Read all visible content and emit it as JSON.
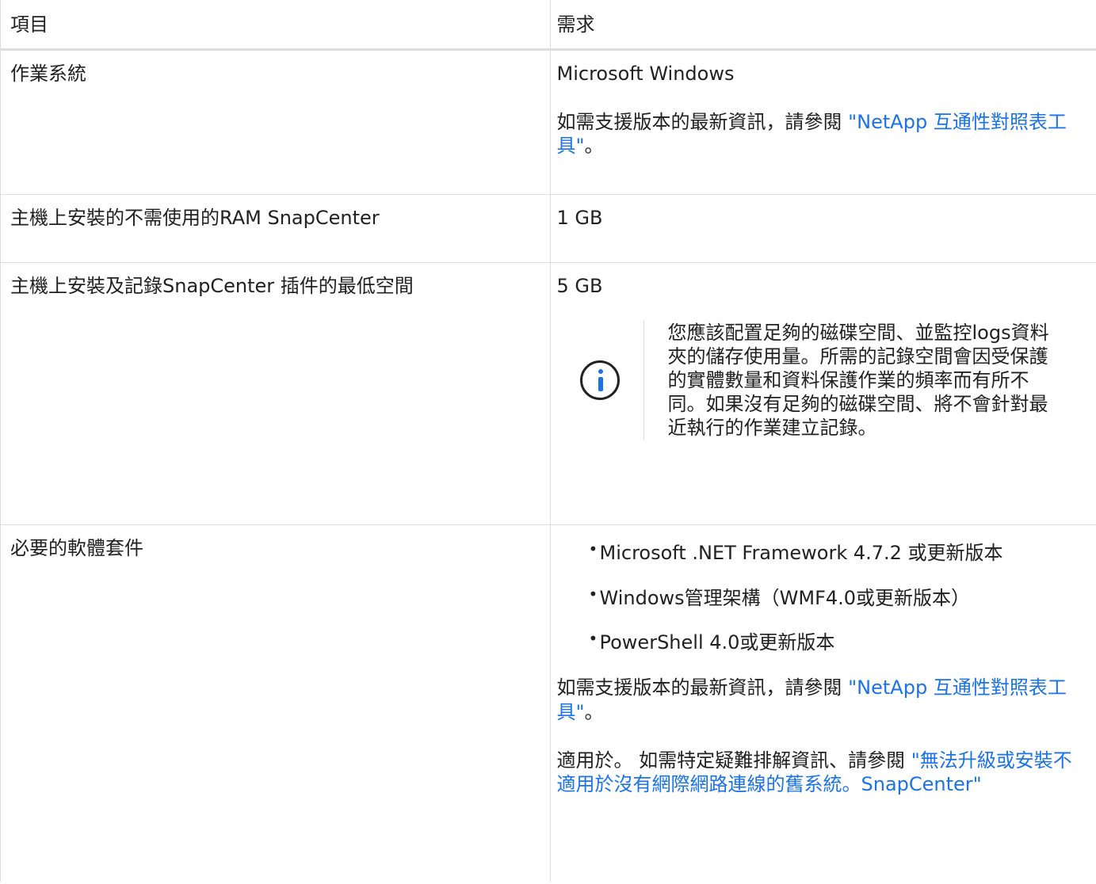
{
  "table": {
    "headers": {
      "item": "項目",
      "requirement": "需求"
    },
    "rows": {
      "os": {
        "item": "作業系統",
        "value": "Microsoft Windows",
        "note_prefix": "如需支援版本的最新資訊，請參閱 ",
        "note_link": "\"NetApp 互通性對照表工具\"",
        "note_suffix": "。"
      },
      "ram": {
        "item": "主機上安裝的不需使用的RAM SnapCenter",
        "value": "1 GB"
      },
      "space": {
        "item": "主機上安裝及記錄SnapCenter 插件的最低空間",
        "value": "5 GB",
        "icon": "info-icon",
        "callout": "您應該配置足夠的磁碟空間、並監控logs資料夾的儲存使用量。所需的記錄空間會因受保護的實體數量和資料保護作業的頻率而有所不同。如果沒有足夠的磁碟空間、將不會針對最近執行的作業建立記錄。"
      },
      "software": {
        "item": "必要的軟體套件",
        "bullets": [
          "Microsoft .NET Framework 4.7.2 或更新版本",
          "Windows管理架構（WMF4.0或更新版本）",
          "PowerShell 4.0或更新版本"
        ],
        "note_prefix": "如需支援版本的最新資訊，請參閱 ",
        "note_link": "\"NetApp 互通性對照表工具\"",
        "note_suffix": "。",
        "extra_prefix": "適用於。 如需特定疑難排解資訊、請參閱 ",
        "extra_link": "\"無法升級或安裝不適用於沒有網際網路連線的舊系統。SnapCenter\""
      }
    }
  },
  "colors": {
    "link": "#1a73e8",
    "border": "#dddddd",
    "text": "#212121"
  }
}
